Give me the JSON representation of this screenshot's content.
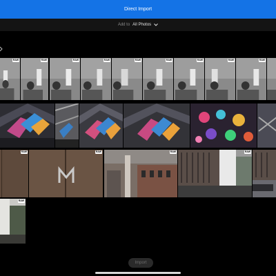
{
  "header": {
    "title": "Direct Import"
  },
  "add_to": {
    "label": "Add to",
    "value": "All Photos"
  },
  "photos": {
    "raw_badge": "RAW",
    "row1_statue_count": 8,
    "row2_count": 5,
    "row3_count": 5,
    "row4_count": 1
  },
  "footer": {
    "import_label": "Import"
  },
  "colors": {
    "header_blue": "#1473e6",
    "background": "#000000",
    "subbar": "#141414"
  }
}
